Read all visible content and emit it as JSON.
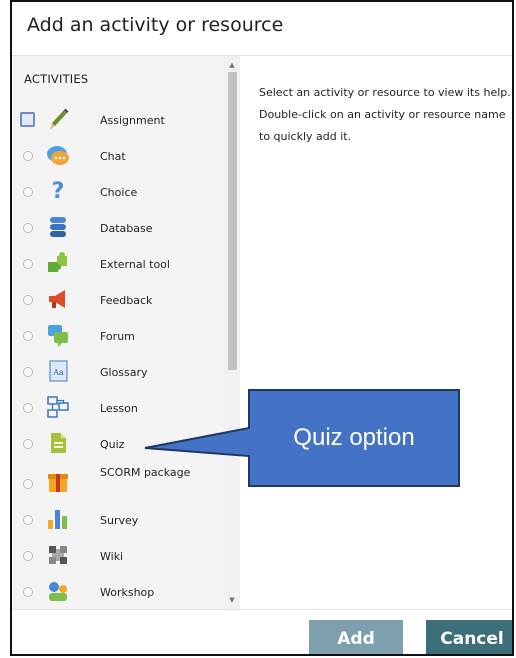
{
  "dialog": {
    "title": "Add an activity or resource"
  },
  "activities": {
    "heading": "ACTIVITIES",
    "items": [
      {
        "label": "Assignment",
        "icon": "assignment-icon"
      },
      {
        "label": "Chat",
        "icon": "chat-icon"
      },
      {
        "label": "Choice",
        "icon": "choice-icon"
      },
      {
        "label": "Database",
        "icon": "database-icon"
      },
      {
        "label": "External tool",
        "icon": "external-tool-icon"
      },
      {
        "label": "Feedback",
        "icon": "feedback-icon"
      },
      {
        "label": "Forum",
        "icon": "forum-icon"
      },
      {
        "label": "Glossary",
        "icon": "glossary-icon"
      },
      {
        "label": "Lesson",
        "icon": "lesson-icon"
      },
      {
        "label": "Quiz",
        "icon": "quiz-icon"
      },
      {
        "label": "SCORM package",
        "icon": "scorm-package-icon"
      },
      {
        "label": "Survey",
        "icon": "survey-icon"
      },
      {
        "label": "Wiki",
        "icon": "wiki-icon"
      },
      {
        "label": "Workshop",
        "icon": "workshop-icon"
      }
    ]
  },
  "help": {
    "text": "Select an activity or resource to view its help. Double-click on an activity or resource name to quickly add it."
  },
  "footer": {
    "add_label": "Add",
    "cancel_label": "Cancel"
  },
  "annotation": {
    "text": "Quiz option"
  },
  "colors": {
    "add_button": "#7d9fae",
    "cancel_button": "#3c6f7a",
    "callout_fill": "#4472c4",
    "callout_border": "#1f3864"
  }
}
